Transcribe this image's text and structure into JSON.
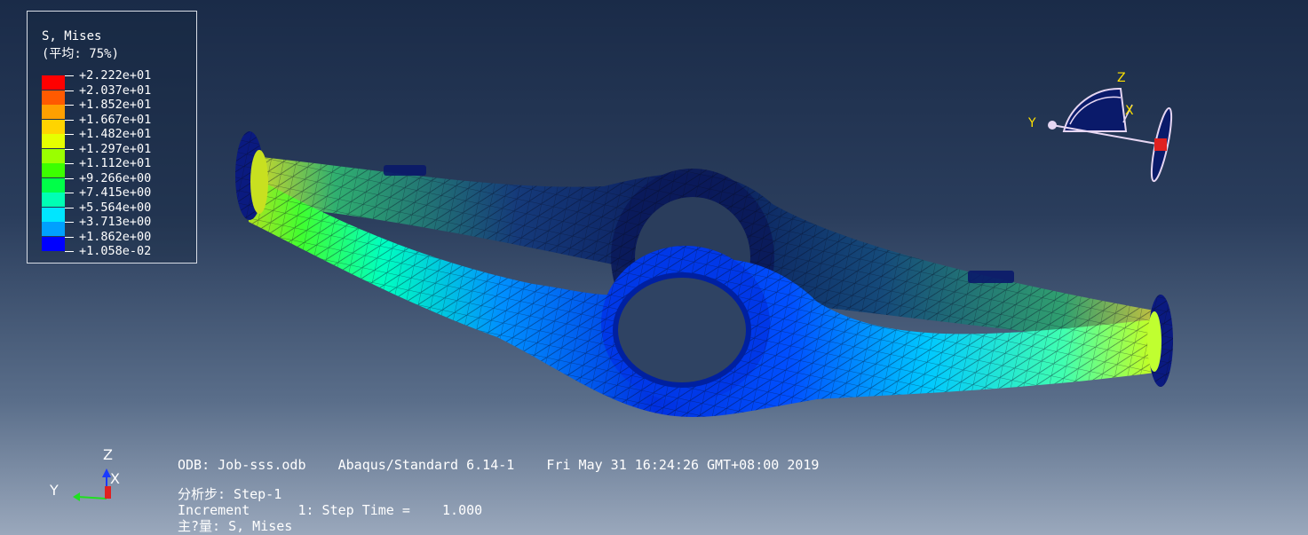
{
  "legend": {
    "title": "S, Mises",
    "subtitle": "(平均: 75%)",
    "levels": [
      {
        "label": "+2.222e+01",
        "color": "#ff0000"
      },
      {
        "label": "+2.037e+01",
        "color": "#ff5a00"
      },
      {
        "label": "+1.852e+01",
        "color": "#ffa000"
      },
      {
        "label": "+1.667e+01",
        "color": "#ffd400"
      },
      {
        "label": "+1.482e+01",
        "color": "#e6ff00"
      },
      {
        "label": "+1.297e+01",
        "color": "#9aff00"
      },
      {
        "label": "+1.112e+01",
        "color": "#3cff00"
      },
      {
        "label": "+9.266e+00",
        "color": "#00ff48"
      },
      {
        "label": "+7.415e+00",
        "color": "#00ffb4"
      },
      {
        "label": "+5.564e+00",
        "color": "#00e6ff"
      },
      {
        "label": "+3.713e+00",
        "color": "#00a0ff"
      },
      {
        "label": "+1.862e+00",
        "color": "#0050ff"
      },
      {
        "label": "+1.058e-02",
        "color": "#0000ff"
      }
    ]
  },
  "triad_top": {
    "z": "Z",
    "x": "X",
    "y": "Y"
  },
  "triad_bottom": {
    "z": "Z",
    "x": "X",
    "y": "Y"
  },
  "info": {
    "odb_line": "ODB: Job-sss.odb    Abaqus/Standard 6.14-1    Fri May 31 16:24:26 GMT+08:00 2019",
    "step_line": "分析步: Step-1",
    "increment_line": "Increment      1: Step Time =    1.000",
    "variable_line": "主?量: S, Mises"
  },
  "colors": {
    "background_top": "#1a2b48",
    "background_bottom": "#9aa8bc",
    "mesh_line": "#0a0f2a"
  }
}
